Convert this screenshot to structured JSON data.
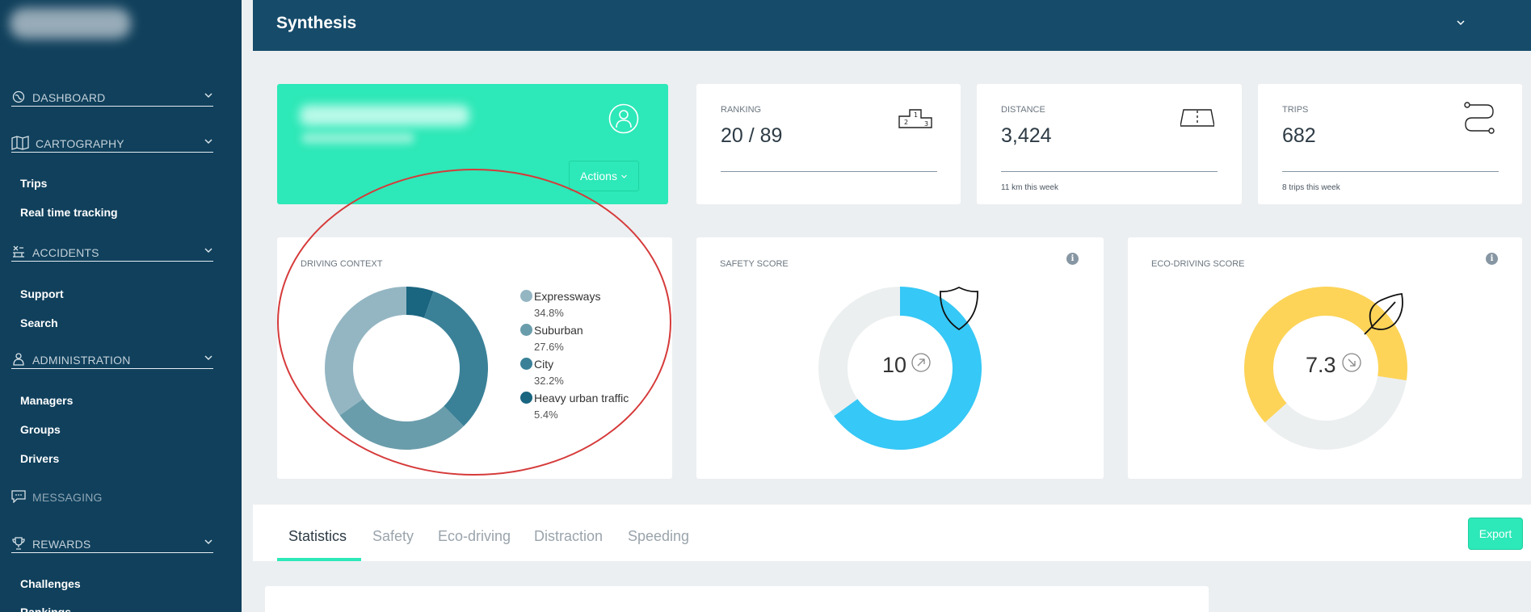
{
  "sidebar": {
    "sections": [
      {
        "label": "DASHBOARD",
        "icon": "globe-icon"
      },
      {
        "label": "CARTOGRAPHY",
        "icon": "map-icon"
      },
      {
        "label": "ACCIDENTS",
        "icon": "crash-icon"
      },
      {
        "label": "ADMINISTRATION",
        "icon": "admin-icon"
      },
      {
        "label": "MESSAGING",
        "icon": "chat-icon"
      },
      {
        "label": "REWARDS",
        "icon": "trophy-icon"
      }
    ],
    "cartography_items": [
      "Trips",
      "Real time tracking"
    ],
    "accidents_items": [
      "Support",
      "Search"
    ],
    "administration_items": [
      "Managers",
      "Groups",
      "Drivers"
    ],
    "rewards_items": [
      "Challenges",
      "Rankings"
    ]
  },
  "header": {
    "title": "Synthesis"
  },
  "user_card": {
    "actions_label": "Actions"
  },
  "stats": [
    {
      "label": "RANKING",
      "value": "20 / 89",
      "sub": ""
    },
    {
      "label": "DISTANCE",
      "value": "3,424",
      "sub": "11 km this week"
    },
    {
      "label": "TRIPS",
      "value": "682",
      "sub": "8 trips this week"
    }
  ],
  "driving_context": {
    "title": "DRIVING CONTEXT",
    "chart_data": {
      "type": "pie",
      "categories": [
        "Expressways",
        "Suburban",
        "City",
        "Heavy urban traffic"
      ],
      "values": [
        34.8,
        27.6,
        32.2,
        5.4
      ],
      "labels": [
        "34.8%",
        "27.6%",
        "32.2%",
        "5.4%"
      ],
      "colors": [
        "#94b6c3",
        "#6a9dab",
        "#3a8198",
        "#1a6580"
      ],
      "legend": "right"
    }
  },
  "safety_score": {
    "title": "SAFETY SCORE",
    "value": "10",
    "fraction": 0.65,
    "color": "#36c8f6",
    "icon": "shield-icon",
    "trend": "up-right-arrow-icon"
  },
  "eco_score": {
    "title": "ECO-DRIVING SCORE",
    "value": "7.3",
    "fraction": 0.64,
    "color": "#fdd458",
    "icon": "leaf-icon",
    "trend": "down-right-arrow-icon"
  },
  "tabs": [
    "Statistics",
    "Safety",
    "Eco-driving",
    "Distraction",
    "Speeding"
  ],
  "export_label": "Export"
}
